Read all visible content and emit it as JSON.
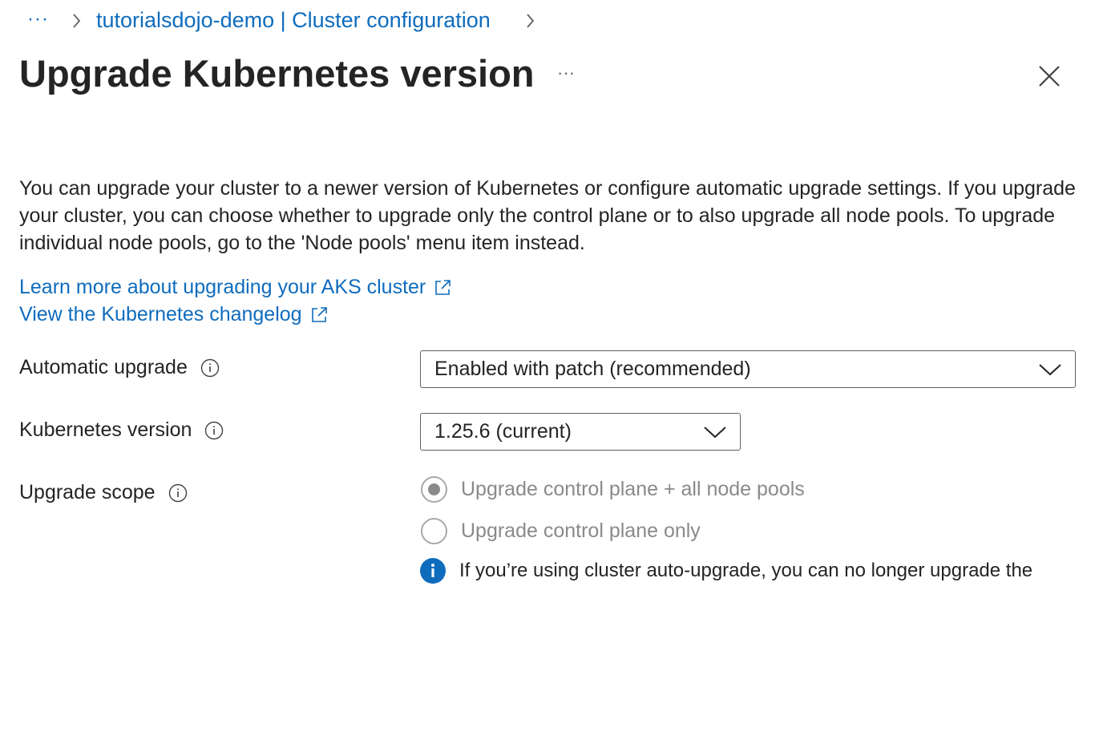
{
  "breadcrumb": {
    "ellipsis": "···",
    "items": [
      {
        "label": "tutorialsdojo-demo | Cluster configuration"
      }
    ],
    "separator_icon": "chevron-right-icon"
  },
  "header": {
    "title": "Upgrade Kubernetes version",
    "more_label": "···",
    "close_icon": "close-icon"
  },
  "description": "You can upgrade your cluster to a newer version of Kubernetes or configure automatic upgrade settings. If you upgrade your cluster, you can choose whether to upgrade only the control plane or to also upgrade all node pools. To upgrade individual node pools, go to the 'Node pools' menu item instead.",
  "links": [
    {
      "label": "Learn more about upgrading your AKS cluster",
      "icon": "external-link-icon"
    },
    {
      "label": "View the Kubernetes changelog",
      "icon": "external-link-icon"
    }
  ],
  "form": {
    "automatic_upgrade": {
      "label": "Automatic upgrade",
      "value": "Enabled with patch (recommended)"
    },
    "kubernetes_version": {
      "label": "Kubernetes version",
      "value": "1.25.6 (current)"
    },
    "upgrade_scope": {
      "label": "Upgrade scope",
      "options": [
        {
          "label": "Upgrade control plane + all node pools",
          "selected": true,
          "disabled": true
        },
        {
          "label": "Upgrade control plane only",
          "selected": false,
          "disabled": true
        }
      ]
    },
    "info_note": "If you’re using cluster auto-upgrade, you can no longer upgrade the control plane first, and then upgrade the individual node pools."
  },
  "colors": {
    "accent": "#0f6cbd",
    "text": "#242424",
    "disabled_text": "#8a8a8a"
  }
}
